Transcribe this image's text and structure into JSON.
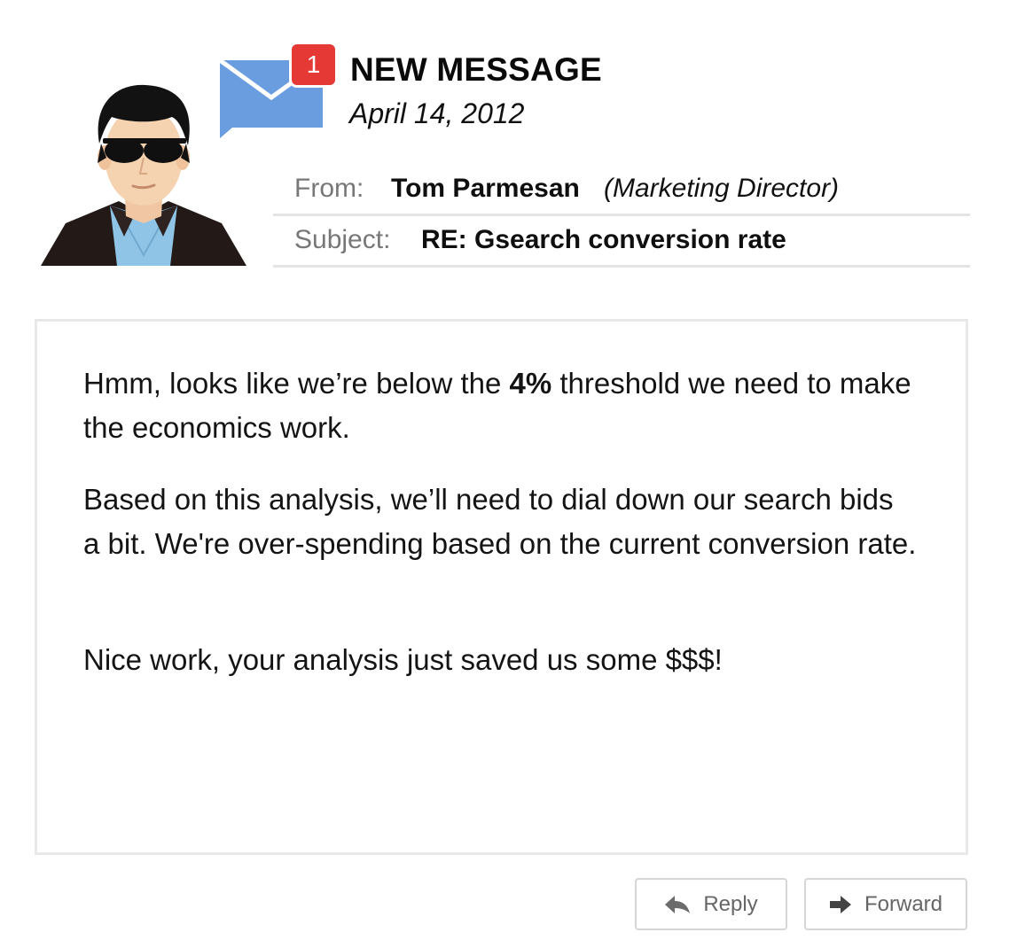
{
  "notification": {
    "count": "1",
    "title": "NEW MESSAGE",
    "date": "April 14, 2012",
    "envelope_color": "#6a9de0",
    "badge_color": "#e53935"
  },
  "meta": {
    "from_label": "From:",
    "from_name": "Tom Parmesan",
    "from_role": "(Marketing Director)",
    "subject_label": "Subject:",
    "subject": "RE: Gsearch conversion rate"
  },
  "body": {
    "p1_before": "Hmm, looks like we’re below the ",
    "p1_bold": "4%",
    "p1_after": " threshold we need to make the economics work.",
    "p2": "Based on this analysis, we’ll need to dial down our search bids a bit. We're over-spending based on the current conversion rate.",
    "p3": "Nice work, your analysis just saved us some $$$!"
  },
  "actions": {
    "reply_label": "Reply",
    "reply_icon": "reply-arrow-icon",
    "forward_label": "Forward",
    "forward_icon": "forward-arrow-icon"
  },
  "avatar": {
    "icon": "man-with-sunglasses-avatar"
  }
}
